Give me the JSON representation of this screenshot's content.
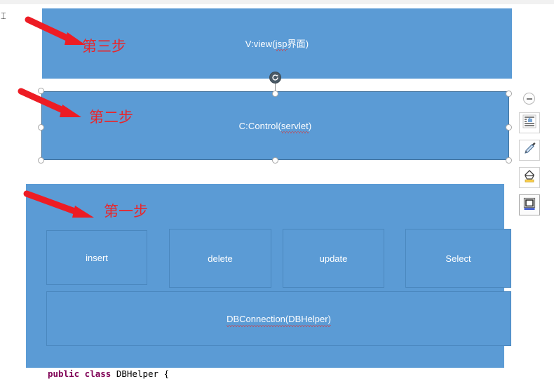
{
  "app": {
    "type": "slide-editor-canvas",
    "accent_blue": "#5B9BD5",
    "annotation_red": "#E8262B",
    "shape_outline": "#41719C"
  },
  "shapes": {
    "view": {
      "label_prefix": "V:view(",
      "label_squiggle": "jsp",
      "label_suffix": "界面)",
      "name": "view-layer-shape"
    },
    "control": {
      "label_prefix": "C:Control(",
      "label_squiggle": "servlet",
      "label_suffix": ")",
      "name": "control-layer-shape",
      "selected": "true"
    },
    "model": {
      "name": "model-layer-shape"
    }
  },
  "crud_boxes": [
    {
      "label": "insert"
    },
    {
      "label": "delete"
    },
    {
      "label": "update"
    },
    {
      "label": "Select"
    }
  ],
  "db_connection": {
    "label_squiggle": "DBConnection(DBHelper)"
  },
  "annotations": [
    {
      "step_label": "第三步",
      "arrow": "red-arrow-down-right"
    },
    {
      "step_label": "第二步",
      "arrow": "red-arrow-down-right"
    },
    {
      "step_label": "第一步",
      "arrow": "red-arrow-down-right"
    }
  ],
  "mini_toolbar": {
    "buttons": [
      {
        "icon": "collapse-minus-icon",
        "name": "collapse-toolbar-button"
      },
      {
        "icon": "layout-options-icon",
        "name": "layout-options-button"
      },
      {
        "icon": "format-painter-icon",
        "name": "format-painter-button"
      },
      {
        "icon": "fill-color-icon",
        "name": "fill-color-button"
      },
      {
        "icon": "shape-outline-icon",
        "name": "shape-style-button"
      }
    ]
  },
  "code_line": {
    "keyword": "public class",
    "identifier": " DBHelper {"
  },
  "cursor": {
    "glyph": "⌶"
  }
}
